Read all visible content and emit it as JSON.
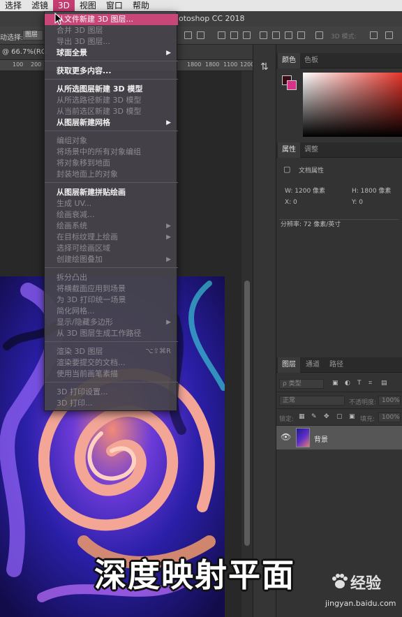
{
  "menubar": {
    "items": [
      {
        "label": "选择"
      },
      {
        "label": "滤镜"
      },
      {
        "label": "3D"
      },
      {
        "label": "视图"
      },
      {
        "label": "窗口"
      },
      {
        "label": "帮助"
      }
    ]
  },
  "titlebar": {
    "title": "otoshop CC 2018"
  },
  "optionsbar": {
    "label": "动选择:",
    "select_value": "图层",
    "mode_label": "3D 模式:"
  },
  "document": {
    "tab_label": "@ 66.7%(RG"
  },
  "ruler": {
    "ticks": [
      "100",
      "200",
      "1800",
      "1800",
      "1100",
      "1200"
    ]
  },
  "menu": {
    "items": [
      {
        "label": "从文件新建 3D 图层...",
        "state": "hl"
      },
      {
        "label": "合并 3D 图层",
        "state": "dis"
      },
      {
        "label": "导出 3D 图层...",
        "state": "dis"
      },
      {
        "label": "球面全景",
        "state": "en",
        "submenu": "▶"
      },
      {
        "label": "获取更多内容...",
        "state": "en"
      },
      {
        "label": "从所选图层新建 3D 模型",
        "state": "en"
      },
      {
        "label": "从所选路径新建 3D 模型",
        "state": "dis"
      },
      {
        "label": "从当前选区新建 3D 模型",
        "state": "dis"
      },
      {
        "label": "从图层新建网格",
        "state": "en",
        "submenu": "▶"
      },
      {
        "label": "编组对象",
        "state": "dis"
      },
      {
        "label": "将场景中的所有对象编组",
        "state": "dis"
      },
      {
        "label": "将对象移到地面",
        "state": "dis"
      },
      {
        "label": "封装地面上的对象",
        "state": "dis"
      },
      {
        "label": "从图层新建拼贴绘画",
        "state": "en"
      },
      {
        "label": "生成 UV...",
        "state": "dis"
      },
      {
        "label": "绘画衰减...",
        "state": "dis"
      },
      {
        "label": "绘画系统",
        "state": "dis",
        "submenu": "▶"
      },
      {
        "label": "在目标纹理上绘画",
        "state": "dis",
        "submenu": "▶"
      },
      {
        "label": "选择可绘画区域",
        "state": "dis"
      },
      {
        "label": "创建绘图叠加",
        "state": "dis",
        "submenu": "▶"
      },
      {
        "label": "拆分凸出",
        "state": "dis"
      },
      {
        "label": "将横截面应用到场景",
        "state": "dis"
      },
      {
        "label": "为 3D 打印统一场景",
        "state": "dis"
      },
      {
        "label": "简化网格...",
        "state": "dis"
      },
      {
        "label": "显示/隐藏多边形",
        "state": "dis",
        "submenu": "▶"
      },
      {
        "label": "从 3D 图层生成工作路径",
        "state": "dis"
      },
      {
        "label": "渲染 3D 图层",
        "state": "dis",
        "shortcut": "⌥⇧⌘R"
      },
      {
        "label": "渲染要提交的文档...",
        "state": "dis"
      },
      {
        "label": "使用当前画笔素描",
        "state": "dis"
      },
      {
        "label": "3D 打印设置...",
        "state": "dis"
      },
      {
        "label": "3D 打印...",
        "state": "dis"
      }
    ]
  },
  "color_panel": {
    "tabs": [
      "颜色",
      "色板"
    ],
    "fg_color": "#3a0d16",
    "bg_color": "#d63388"
  },
  "properties_panel": {
    "tabs": [
      "属性",
      "调整"
    ],
    "section": "文档属性",
    "width": "W: 1200 像素",
    "height": "H: 1800 像素",
    "x": "X: 0",
    "y": "Y: 0",
    "resolution": "分辨率: 72 像素/英寸"
  },
  "layers_panel": {
    "tabs": [
      "图层",
      "通道",
      "路径"
    ],
    "filter_label": "ρ 类型",
    "blend_mode": "正常",
    "opacity_label": "不透明度:",
    "opacity_value": "100%",
    "lock_label": "锁定:",
    "fill_label": "填充:",
    "fill_value": "100%",
    "layer_name": "背景"
  },
  "caption": {
    "text": "深度映射平面"
  },
  "watermark": {
    "brand": "经验",
    "url": "jingyan.baidu.com"
  },
  "colors": {
    "accent": "#c94678",
    "menu_bg": "#46444a"
  }
}
